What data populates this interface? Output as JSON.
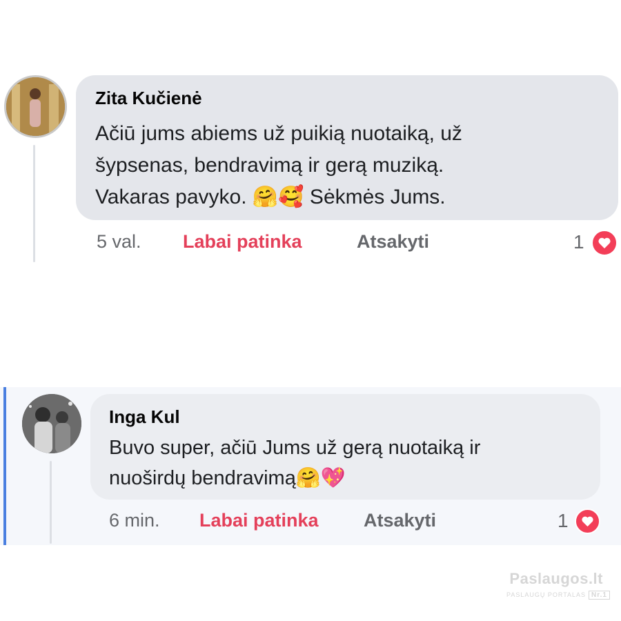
{
  "comments": [
    {
      "author": "Zita Kučienė",
      "text_lines": [
        "Ačiū jums abiems už puikią nuotaiką, už",
        "šypsenas, bendravimą ir gerą muziką.",
        "Vakaras pavyko. 🤗🥰 Sėkmės Jums."
      ],
      "time": "5 val.",
      "like_label": "Labai patinka",
      "reply_label": "Atsakyti",
      "reaction_count": "1",
      "reaction_icon": "heart-icon"
    },
    {
      "author": "Inga Kul",
      "text_lines": [
        "Buvo super, ačiū Jums už gerą nuotaiką ir",
        "nuoširdų bendravimą🤗💖"
      ],
      "time": "6 min.",
      "like_label": "Labai patinka",
      "reply_label": "Atsakyti",
      "reaction_count": "1",
      "reaction_icon": "heart-icon"
    }
  ],
  "watermark": {
    "main": "Paslaugos.lt",
    "sub": "PASLAUGŲ PORTALAS",
    "badge": "Nr.1"
  },
  "colors": {
    "like": "#e4405a",
    "heart": "#f33e58",
    "bubble_1": "#e4e6eb",
    "bubble_2": "#ebedf1",
    "highlight_bar": "#4a7fe0"
  }
}
